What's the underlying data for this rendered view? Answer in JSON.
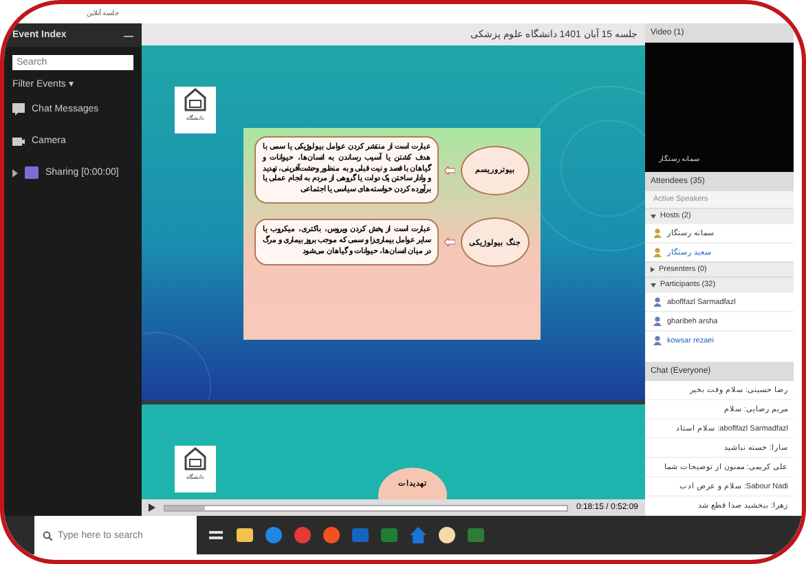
{
  "window": {
    "title": "جلسه آنلاین"
  },
  "event_index": {
    "title": "Event Index",
    "search": {
      "placeholder": "Search"
    },
    "filter": "Filter Events ▾",
    "items": [
      {
        "label": "Chat Messages",
        "kind": "chat"
      },
      {
        "label": "Camera",
        "kind": "camera"
      },
      {
        "label": "Sharing [0:00:00]",
        "kind": "sharing"
      }
    ]
  },
  "share_pod": {
    "title": "جلسه 15 آبان 1401 دانشگاه علوم پزشکی",
    "slides": [
      {
        "logo_caption": "دانشگاه",
        "topics": [
          {
            "heading": "بیوتروریسم",
            "text": "عبارت است از منتشر کردن عوامل بیولوژیکی یا سمی با هدف کشتن یا آسیب رساندن به انسان‌ها، حیوانات و گیاهان با قصد و نیت قبلی و به منظور وحشت‌آفرینی، تهدید و وادار ساختن یک دولت یا گروهی از مردم به انجام عملی یا برآورده کردن خواسته‌های سیاسی یا اجتماعی"
          },
          {
            "heading": "جنگ بیولوژیکی",
            "text": "عبارت است از پخش کردن ویروس، باکتری، میکروب یا سایر عوامل بیماری‌زا و سمی که موجب بروز بیماری و مرگ در میان انسان‌ها، حیوانات و گیاهان می‌شود"
          }
        ]
      },
      {
        "logo_caption": "دانشگاه",
        "topics": [
          {
            "heading": "تهدیدات"
          }
        ]
      }
    ]
  },
  "player": {
    "time": "0:18:15 / 0:52:09",
    "level": 0.1
  },
  "video": {
    "title": "Video (1)",
    "caption": "سمانه رستگار"
  },
  "attendees": {
    "title": "Attendees (35)",
    "active_speakers": "Active Speakers",
    "groups": [
      {
        "label": "Hosts (2)",
        "expanded": true,
        "people": [
          {
            "name": "سمانه رستگار",
            "selected": false
          },
          {
            "name": "سعید رستگار",
            "selected": true
          }
        ]
      },
      {
        "label": "Presenters (0)",
        "expanded": false
      },
      {
        "label": "Participants (32)",
        "expanded": true,
        "people": [
          {
            "name": "aboflfazl Sarmadfazl",
            "selected": false
          },
          {
            "name": "gharibeh arsha",
            "selected": false
          },
          {
            "name": "kowsar rezaei",
            "selected": true
          }
        ]
      }
    ]
  },
  "chat": {
    "title": "Chat (Everyone)",
    "messages": [
      "رضا حسینی: سلام وقت بخیر",
      "مریم رضایی: سلام",
      "aboflfazl Sarmadfazl: سلام استاد",
      "سارا: خسته نباشید",
      "علی کریمی: ممنون از توضیحات شما",
      "Sabour Nadi: سلام و عرض ادب",
      "زهرا: ببخشید صدا قطع شد"
    ]
  },
  "taskbar": {
    "search": {
      "placeholder": "Type here to search"
    },
    "apps": [
      {
        "kind": "taskview"
      },
      {
        "kind": "folder"
      },
      {
        "kind": "edge"
      },
      {
        "kind": "chrome"
      },
      {
        "kind": "firefox"
      },
      {
        "kind": "blue"
      },
      {
        "kind": "excel"
      },
      {
        "kind": "home"
      },
      {
        "kind": "round"
      },
      {
        "kind": "green"
      }
    ]
  }
}
